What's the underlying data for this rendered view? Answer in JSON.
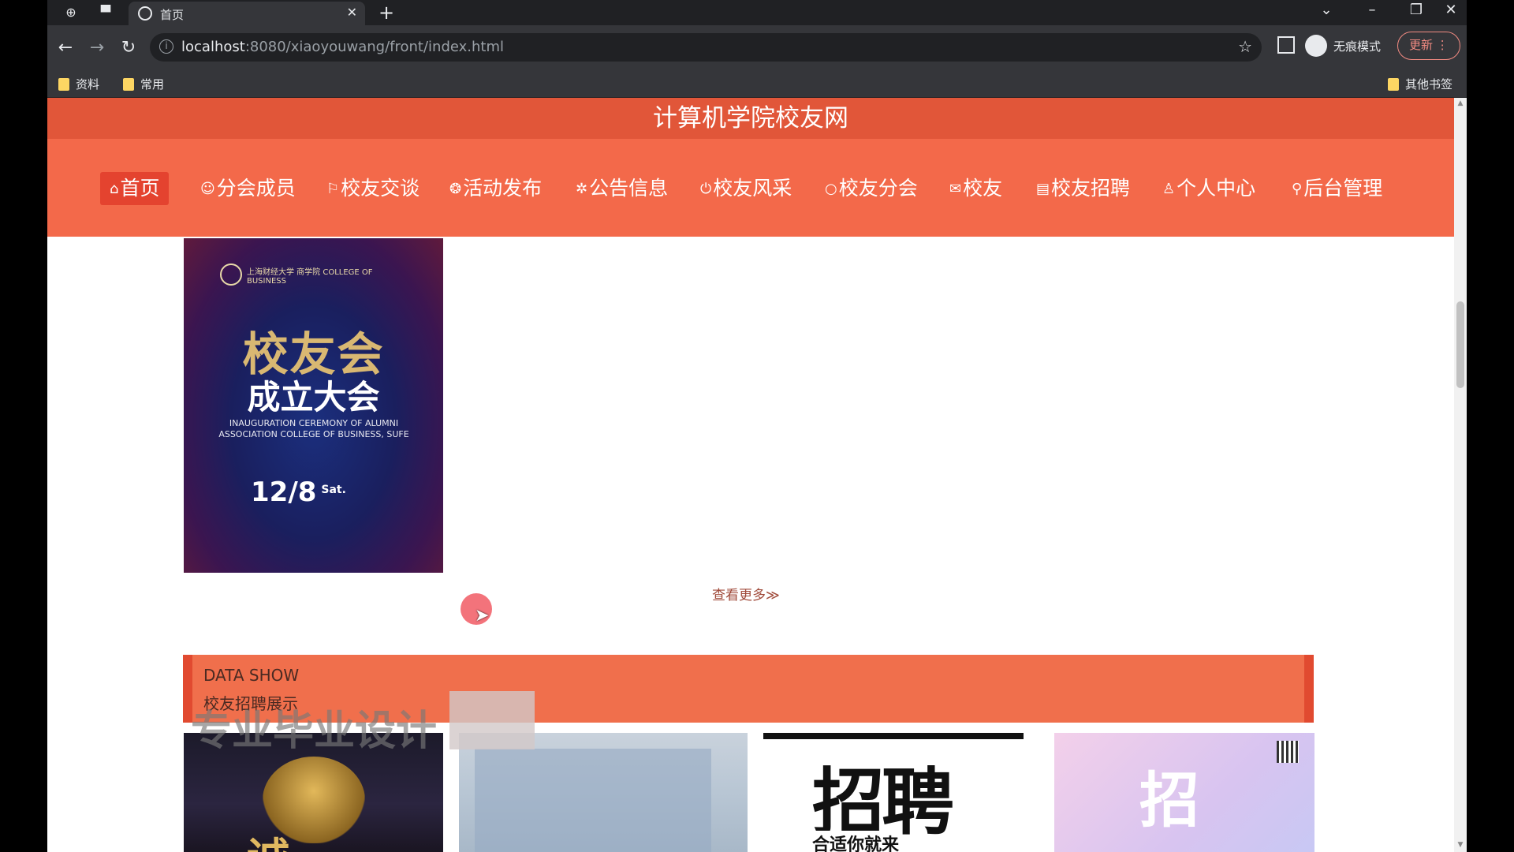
{
  "browser": {
    "tab_title": "首页",
    "url_host": "localhost",
    "url_path": ":8080/xiaoyouwang/front/index.html",
    "incognito_label": "无痕模式",
    "update_label": "更新",
    "bookmarks": [
      "资料",
      "常用"
    ],
    "other_bookmarks": "其他书签"
  },
  "site": {
    "title": "计算机学院校友网",
    "nav": [
      {
        "label": "首页",
        "icon": "home-icon"
      },
      {
        "label": "分会成员",
        "icon": "members-icon"
      },
      {
        "label": "校友交谈",
        "icon": "flag-icon"
      },
      {
        "label": "活动发布",
        "icon": "activity-icon"
      },
      {
        "label": "公告信息",
        "icon": "notice-icon"
      },
      {
        "label": "校友风采",
        "icon": "power-icon"
      },
      {
        "label": "校友分会",
        "icon": "circle-icon"
      },
      {
        "label": "校友",
        "icon": "mail-icon"
      },
      {
        "label": "校友招聘",
        "icon": "document-icon"
      },
      {
        "label": "个人中心",
        "icon": "user-icon"
      },
      {
        "label": "后台管理",
        "icon": "link-icon"
      }
    ]
  },
  "banner": {
    "logo_text": "上海财经大学 商学院 COLLEGE OF BUSINESS",
    "headline": "校友会",
    "subheadline": "成立大会",
    "english": "INAUGURATION CEREMONY OF ALUMNI ASSOCIATION COLLEGE OF BUSINESS, SUFE",
    "date": "12/8",
    "day": "Sat."
  },
  "more_link": "查看更多≫",
  "data_section": {
    "label_en": "DATA SHOW",
    "label_cn": "校友招聘展示"
  },
  "overlay_caption": "专业毕业设计",
  "cards": {
    "card1_text": "诚",
    "card3_big": "招聘",
    "card3_small": "合适你就来",
    "card4_big": "招"
  },
  "colors": {
    "title_bar": "#e15639",
    "nav_bar": "#f3694a",
    "nav_active": "#e4432f",
    "data_header": "#f06f4c"
  }
}
